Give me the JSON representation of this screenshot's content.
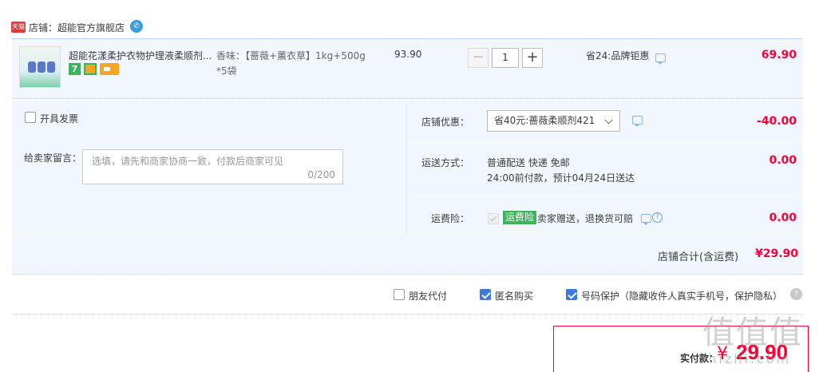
{
  "shop": {
    "badge": "天猫",
    "label": "店铺：超能官方旗舰店"
  },
  "item": {
    "title": "超能花漾柔护衣物护理液柔顺剂...",
    "tag_seven": "7",
    "sku": "香味：【蔷薇+薰衣草】1kg+500g*5袋",
    "unit_price": "93.90",
    "quantity": "1",
    "qty_minus": "−",
    "qty_plus": "+",
    "promo": "省24:品牌钜惠",
    "subtotal": "69.90"
  },
  "invoice": {
    "label": "开具发票"
  },
  "message": {
    "label": "给卖家留言：",
    "placeholder": "选填，请先和商家协商一致，付款后商家可见",
    "count": "0/200"
  },
  "coupon": {
    "label": "店铺优惠：",
    "selected": "省40元:蔷薇柔顺剂421",
    "amount": "-40.00"
  },
  "shipping": {
    "label": "运送方式：",
    "line1": "普通配送 快递 免邮",
    "line2": "24:00前付款，预计04月24日送达",
    "amount": "0.00"
  },
  "insurance": {
    "label": "运费险：",
    "badge": "运费险",
    "text": "卖家赠送，退换货可赔",
    "help": "?",
    "amount": "0.00"
  },
  "shop_total": {
    "label": "店铺合计(含运费)",
    "amount": "¥29.90"
  },
  "options": {
    "friend_pay": "朋友代付",
    "anonymous": "匿名购买",
    "number_protect": "号码保护（隐藏收件人真实手机号，保护隐私）",
    "help": "?"
  },
  "payment": {
    "label": "实付款：",
    "yen": "¥",
    "amount": "29.90"
  },
  "watermark": {
    "logo": "值值值",
    "url": "zhizhi.com"
  },
  "colors": {
    "accent_red": "#ff0036",
    "panel_bg": "#f2f7ff",
    "check_blue": "#3a7be0",
    "insurance_green": "#3cb35d"
  }
}
